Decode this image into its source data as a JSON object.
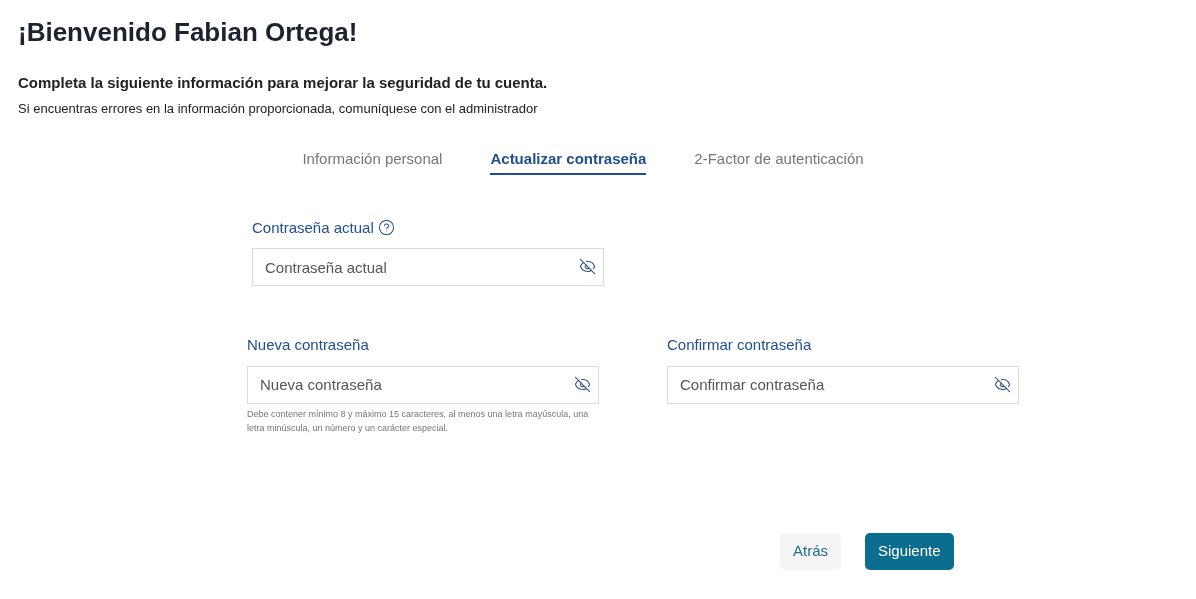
{
  "title": "¡Bienvenido Fabian Ortega!",
  "subtitle": "Completa la siguiente información para mejorar la seguridad de tu cuenta.",
  "note": "Si encuentras errores en la información proporcionada, comuníquese con el administrador",
  "tabs": [
    {
      "label": "Información personal",
      "selected": false
    },
    {
      "label": "Actualizar contraseña",
      "selected": true
    },
    {
      "label": "2-Factor de autenticación",
      "selected": false
    }
  ],
  "current_password": {
    "label": "Contraseña actual",
    "placeholder": "Contraseña actual"
  },
  "new_password": {
    "label": "Nueva contraseña",
    "placeholder": "Nueva contraseña",
    "hint": "Debe contener mínimo 8 y máximo 15 caracteres, al menos una letra mayúscula, una letra minúscula, un número y un carácter especial."
  },
  "confirm_password": {
    "label": "Confirmar contraseña",
    "placeholder": "Confirmar contraseña"
  },
  "buttons": {
    "back": "Atrás",
    "next": "Siguiente"
  }
}
